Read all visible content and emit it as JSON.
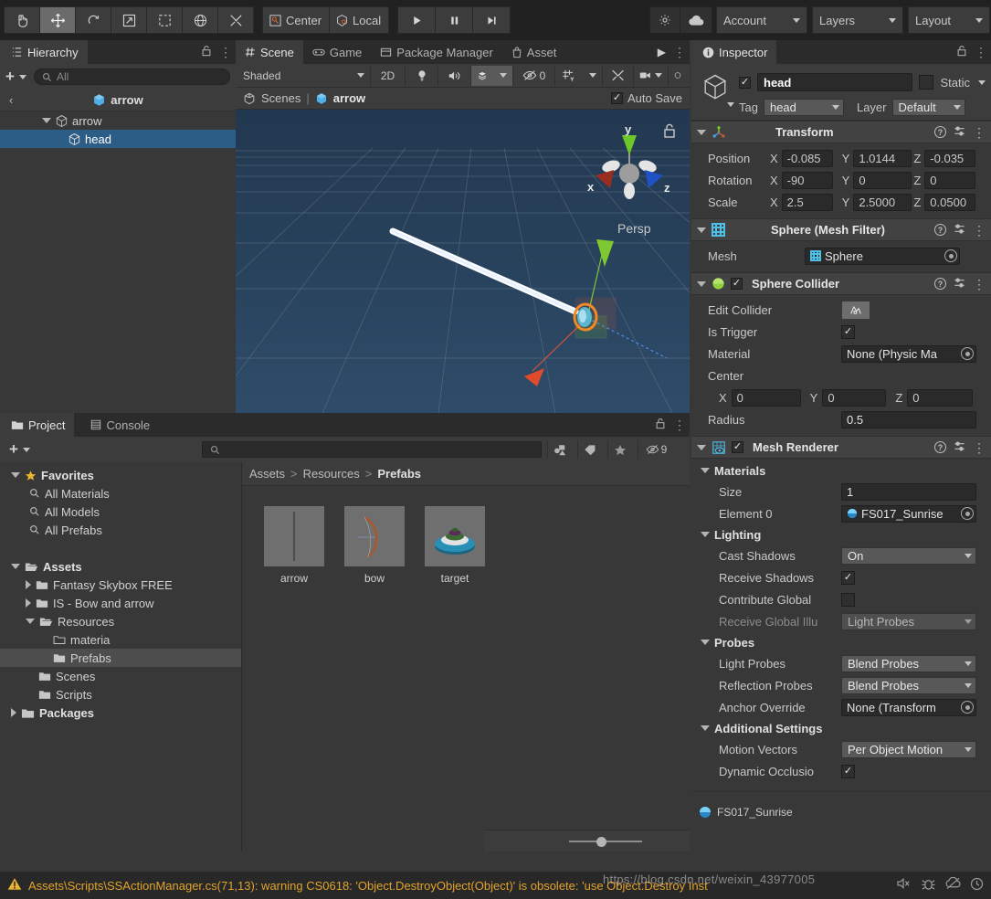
{
  "toolbar": {
    "tools": [
      {
        "name": "hand-tool",
        "icon": "✋",
        "active": false
      },
      {
        "name": "move-tool",
        "icon": "✥",
        "active": true
      },
      {
        "name": "rotate-tool",
        "icon": "↺",
        "active": false
      },
      {
        "name": "scale-tool",
        "icon": "⇱",
        "active": false
      },
      {
        "name": "rect-tool",
        "icon": "⬚",
        "active": false
      },
      {
        "name": "transform-tool",
        "icon": "✣",
        "active": false
      },
      {
        "name": "custom-editor-tool",
        "icon": "⚒",
        "active": false
      }
    ],
    "pivot_label": "Center",
    "space_label": "Local",
    "play_label": "▶",
    "pause_label": "❚❚",
    "step_label": "▶|",
    "collab_label": "",
    "cloud_label": "",
    "account_label": "Account",
    "layers_label": "Layers",
    "layout_label": "Layout"
  },
  "hierarchy": {
    "tab_label": "Hierarchy",
    "search_placeholder": "All",
    "add_label": "+",
    "breadcrumb": "arrow",
    "items": [
      {
        "label": "arrow",
        "depth": 1,
        "expanded": true,
        "selected": false
      },
      {
        "label": "head",
        "depth": 2,
        "expanded": false,
        "selected": true
      }
    ]
  },
  "scene": {
    "tabs": [
      {
        "label": "Scene",
        "icon": "#",
        "selected": true
      },
      {
        "label": "Game",
        "icon": "🎮",
        "selected": false
      },
      {
        "label": "Package Manager",
        "icon": "▤",
        "selected": false
      },
      {
        "label": "Asset",
        "icon": "🛍",
        "selected": false
      }
    ],
    "shading_mode": "Shaded",
    "mode_2d": "2D",
    "gizmo_count": "0",
    "path_scene": "Scenes",
    "path_object": "arrow",
    "auto_save_label": "Auto Save",
    "auto_save_checked": true,
    "gizmo_axes": {
      "x": "x",
      "y": "y",
      "z": "z"
    },
    "projection_label": "Persp"
  },
  "project": {
    "tabs": [
      {
        "label": "Project",
        "icon": "📁",
        "selected": true
      },
      {
        "label": "Console",
        "icon": "▤",
        "selected": false
      }
    ],
    "add_label": "+",
    "search_placeholder": "",
    "hidden_count": "9",
    "tree": [
      {
        "label": "Favorites",
        "depth": 0,
        "arrow": "down",
        "icon": "star",
        "bold": true,
        "selected": false
      },
      {
        "label": "All Materials",
        "depth": 1,
        "arrow": "none",
        "icon": "search",
        "bold": false,
        "selected": false
      },
      {
        "label": "All Models",
        "depth": 1,
        "arrow": "none",
        "icon": "search",
        "bold": false,
        "selected": false
      },
      {
        "label": "All Prefabs",
        "depth": 1,
        "arrow": "none",
        "icon": "search",
        "bold": false,
        "selected": false
      },
      {
        "label": "",
        "depth": 0,
        "arrow": "none",
        "icon": "none",
        "bold": false,
        "selected": false
      },
      {
        "label": "Assets",
        "depth": 0,
        "arrow": "down",
        "icon": "folder-open",
        "bold": true,
        "selected": false
      },
      {
        "label": "Fantasy Skybox FREE",
        "depth": 1,
        "arrow": "right",
        "icon": "folder",
        "bold": false,
        "selected": false
      },
      {
        "label": "IS - Bow and arrow",
        "depth": 1,
        "arrow": "right",
        "icon": "folder",
        "bold": false,
        "selected": false
      },
      {
        "label": "Resources",
        "depth": 1,
        "arrow": "down",
        "icon": "folder-open",
        "bold": false,
        "selected": false
      },
      {
        "label": "materia",
        "depth": 2,
        "arrow": "none",
        "icon": "folder-empty",
        "bold": false,
        "selected": false
      },
      {
        "label": "Prefabs",
        "depth": 2,
        "arrow": "none",
        "icon": "folder",
        "bold": false,
        "selected": true
      },
      {
        "label": "Scenes",
        "depth": 1,
        "arrow": "none",
        "icon": "folder",
        "bold": false,
        "selected": false
      },
      {
        "label": "Scripts",
        "depth": 1,
        "arrow": "none",
        "icon": "folder",
        "bold": false,
        "selected": false
      },
      {
        "label": "Packages",
        "depth": 0,
        "arrow": "right",
        "icon": "folder",
        "bold": true,
        "selected": false
      }
    ],
    "breadcrumb": [
      "Assets",
      "Resources",
      "Prefabs"
    ],
    "assets": [
      {
        "label": "arrow",
        "kind": "arrow"
      },
      {
        "label": "bow",
        "kind": "bow"
      },
      {
        "label": "target",
        "kind": "target"
      }
    ]
  },
  "inspector": {
    "tab_label": "Inspector",
    "object_name": "head",
    "enabled": true,
    "static_label": "Static",
    "static_checked": false,
    "tag_label": "Tag",
    "tag_value": "head",
    "layer_label": "Layer",
    "layer_value": "Default",
    "components": [
      {
        "name": "Transform",
        "icon": "transform",
        "rows": [
          {
            "type": "vec3",
            "label": "Position",
            "x": "-0.085",
            "y": "1.0144",
            "z": "-0.035"
          },
          {
            "type": "vec3",
            "label": "Rotation",
            "x": "-90",
            "y": "0",
            "z": "0"
          },
          {
            "type": "vec3",
            "label": "Scale",
            "x": "2.5",
            "y": "2.5000",
            "z": "0.0500"
          }
        ]
      },
      {
        "name": "Sphere (Mesh Filter)",
        "icon": "mesh",
        "rows": [
          {
            "type": "object",
            "label": "Mesh",
            "value": "Sphere",
            "value_icon": "mesh"
          }
        ]
      },
      {
        "name": "Sphere Collider",
        "icon": "collider",
        "checked": true,
        "rows": [
          {
            "type": "button",
            "label": "Edit Collider",
            "value": "⌂"
          },
          {
            "type": "check",
            "label": "Is Trigger",
            "checked": true
          },
          {
            "type": "object",
            "label": "Material",
            "value": "None (Physic Ma"
          },
          {
            "type": "header",
            "label": "Center"
          },
          {
            "type": "vec3indent",
            "label": "",
            "x": "0",
            "y": "0",
            "z": "0"
          },
          {
            "type": "single",
            "label": "Radius",
            "value": "0.5"
          }
        ]
      },
      {
        "name": "Mesh Renderer",
        "icon": "renderer",
        "checked": true,
        "rows": [
          {
            "type": "foldout",
            "label": "Materials"
          },
          {
            "type": "single2",
            "label": "Size",
            "value": "1"
          },
          {
            "type": "object2",
            "label": "Element 0",
            "value": "FS017_Sunrise",
            "value_icon": "material"
          },
          {
            "type": "foldout",
            "label": "Lighting"
          },
          {
            "type": "dropdown2",
            "label": "Cast Shadows",
            "value": "On"
          },
          {
            "type": "check2",
            "label": "Receive Shadows",
            "checked": true
          },
          {
            "type": "check2",
            "label": "Contribute Global",
            "checked": false
          },
          {
            "type": "dropdown2dim",
            "label": "Receive Global Illu",
            "value": "Light Probes"
          },
          {
            "type": "foldout",
            "label": "Probes"
          },
          {
            "type": "dropdown2",
            "label": "Light Probes",
            "value": "Blend Probes"
          },
          {
            "type": "dropdown2",
            "label": "Reflection Probes",
            "value": "Blend Probes"
          },
          {
            "type": "object2",
            "label": "Anchor Override",
            "value": "None (Transform"
          },
          {
            "type": "foldout",
            "label": "Additional Settings"
          },
          {
            "type": "dropdown2",
            "label": "Motion Vectors",
            "value": "Per Object Motion"
          },
          {
            "type": "check2",
            "label": "Dynamic Occlusio",
            "checked": true
          }
        ]
      }
    ]
  },
  "status": {
    "message": "Assets\\Scripts\\SSActionManager.cs(71,13): warning CS0618: 'Object.DestroyObject(Object)' is obsolete: 'use Object.Destroy Inst",
    "warning_icon": "⚠",
    "watermark": "https://blog.csdn.net/weixin_43977005"
  },
  "colors": {
    "accent": "#3b7ecb",
    "selection": "#2c5d87",
    "warning": "#e2a32b",
    "panel": "#383838"
  }
}
